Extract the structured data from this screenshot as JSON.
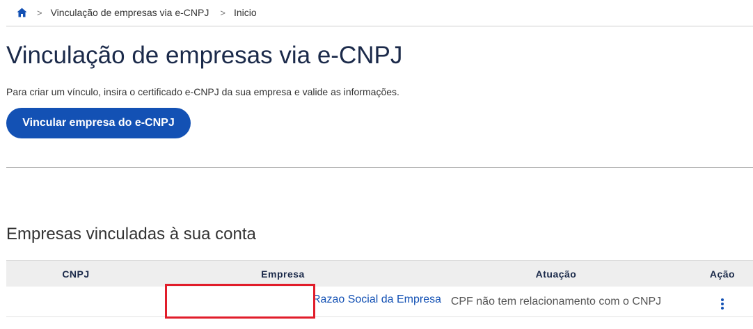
{
  "breadcrumb": {
    "home_icon": "home-icon",
    "separator": ">",
    "items": [
      {
        "label": "Vinculação de empresas via e-CNPJ"
      },
      {
        "label": "Inicio"
      }
    ]
  },
  "page": {
    "title": "Vinculação de empresas via e-CNPJ",
    "intro": "Para criar um vínculo, insira o certificado e-CNPJ da sua empresa e valide as informações.",
    "primary_button": "Vincular empresa do e-CNPJ"
  },
  "section": {
    "title": "Empresas vinculadas à sua conta"
  },
  "table": {
    "headers": [
      "CNPJ",
      "Empresa",
      "Atuação",
      "Ação"
    ],
    "rows": [
      {
        "cnpj": "",
        "empresa": "Razao Social da Empresa do CNPJ",
        "atuacao": "CPF não tem relacionamento com o CNPJ",
        "acao_icon": "more-vertical-icon"
      }
    ]
  },
  "colors": {
    "primary": "#1351b4",
    "title": "#1b2a4a",
    "highlight": "#e11d2a"
  }
}
